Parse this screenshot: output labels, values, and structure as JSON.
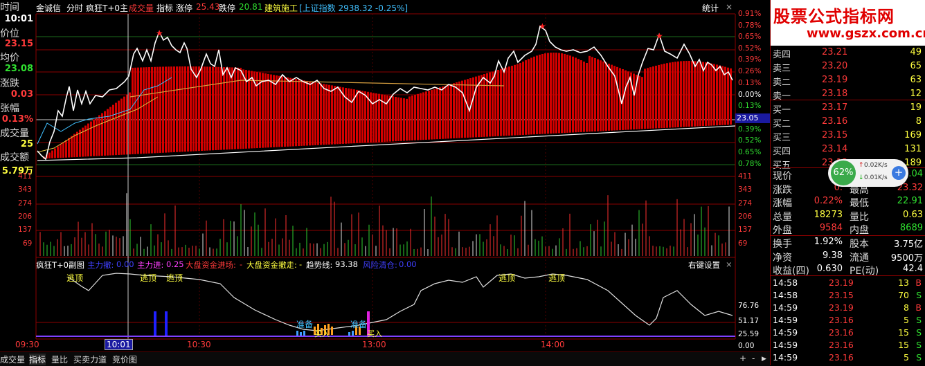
{
  "header": {
    "app_title": "金诚信",
    "mode_label": "分时",
    "indicator_name": "疯狂T+0主",
    "volume_label": "成交量",
    "index_label": "指标",
    "limit_up_label": "涨停",
    "limit_up_value": "25.43",
    "limit_down_label": "跌停",
    "limit_down_value": "20.81",
    "sector_label": "建筑施工",
    "index_quote": "[上证指数 2938.32 -0.25%]",
    "stats_label": "统计"
  },
  "left_panel": {
    "time_label": "时间",
    "time_value": "10:01",
    "price_label": "价位",
    "price_value": "23.15",
    "avg_label": "均价",
    "avg_value": "23.08",
    "change_label": "涨跌",
    "change_value": "0.03",
    "pct_label": "张幅",
    "pct_value": "0.13%",
    "vol_label": "成交量",
    "vol_value": "25",
    "amt_label": "成交额",
    "amt_value": "5.79万"
  },
  "price_axis_right": [
    "0.91%",
    "0.78%",
    "0.65%",
    "0.52%",
    "0.39%",
    "0.26%",
    "0.13%",
    "0.00%",
    "0.13%",
    "0.26%",
    "0.39%",
    "0.52%",
    "0.65%",
    "0.78%"
  ],
  "current_price_tag": "23.05",
  "volume_axis": [
    "411",
    "343",
    "274",
    "206",
    "137",
    "69"
  ],
  "indicator_panel": {
    "title": "疯狂T+0副图",
    "main_force_label": "主力撤:",
    "main_force_value": "0.00",
    "main_in_label": "主力进:",
    "main_in_value": "0.25",
    "market_in_label": "大盘资金进场:",
    "market_in_value": "-",
    "market_out_label": "大盘资金撤走:",
    "market_out_value": "-",
    "trend_label": "趋势线:",
    "trend_value": "93.38",
    "risk_label": "风险清仓:",
    "risk_value": "0.00",
    "right_settings": "右键设置",
    "axis": [
      "76.76",
      "51.17",
      "25.59",
      "0.00"
    ],
    "annotations": {
      "escape": "逃顶",
      "prepare": "准备",
      "buy": "买入"
    }
  },
  "time_axis": [
    "09:30",
    "10:01",
    "10:30",
    "13:00",
    "14:00"
  ],
  "bottom_tabs": [
    "成交量",
    "指标",
    "量比",
    "买卖力道",
    "竞价图"
  ],
  "quote": {
    "asks": [
      {
        "label": "卖四",
        "price": "23.21",
        "vol": "49"
      },
      {
        "label": "卖三",
        "price": "23.20",
        "vol": "65"
      },
      {
        "label": "卖二",
        "price": "23.19",
        "vol": "63"
      },
      {
        "label": "卖一",
        "price": "23.18",
        "vol": "12"
      }
    ],
    "bids": [
      {
        "label": "买一",
        "price": "23.17",
        "vol": "19"
      },
      {
        "label": "买二",
        "price": "23.16",
        "vol": "8"
      },
      {
        "label": "买三",
        "price": "23.15",
        "vol": "169"
      },
      {
        "label": "买四",
        "price": "23.14",
        "vol": "131"
      },
      {
        "label": "买五",
        "price": "23.13",
        "vol": "189"
      }
    ],
    "stats": [
      {
        "l1": "现价",
        "v1": "23",
        "l2": "今开",
        "v2": "23.04"
      },
      {
        "l1": "涨跌",
        "v1": "0.",
        "l2": "最高",
        "v2": "23.32"
      },
      {
        "l1": "涨幅",
        "v1": "0.22%",
        "l2": "最低",
        "v2": "22.91"
      },
      {
        "l1": "总量",
        "v1": "18273",
        "l2": "量比",
        "v2": "0.63"
      },
      {
        "l1": "外盘",
        "v1": "9584",
        "l2": "内盘",
        "v2": "8689"
      }
    ],
    "stats2": [
      {
        "l1": "换手",
        "v1": "1.92%",
        "l2": "股本",
        "v2": "3.75亿"
      },
      {
        "l1": "净资",
        "v1": "9.38",
        "l2": "流通",
        "v2": "9500万"
      },
      {
        "l1": "收益(四)",
        "v1": "0.630",
        "l2": "PE(动)",
        "v2": "42.4"
      }
    ],
    "ticks": [
      {
        "time": "14:58",
        "price": "23.19",
        "vol": "13",
        "side": "B"
      },
      {
        "time": "14:58",
        "price": "23.15",
        "vol": "70",
        "side": "S"
      },
      {
        "time": "14:59",
        "price": "23.19",
        "vol": "8",
        "side": "B"
      },
      {
        "time": "14:59",
        "price": "23.16",
        "vol": "5",
        "side": "S"
      },
      {
        "time": "14:59",
        "price": "23.16",
        "vol": "15",
        "side": "S"
      },
      {
        "time": "14:59",
        "price": "23.16",
        "vol": "15",
        "side": "S"
      },
      {
        "time": "14:59",
        "price": "23.16",
        "vol": "5",
        "side": "S"
      }
    ]
  },
  "watermark": {
    "title": "股票公式指标网",
    "url": "www.gszx.com.cn"
  },
  "speed_widget": {
    "percent": "62%",
    "up": "0.02K/s",
    "down": "0.01K/s"
  }
}
